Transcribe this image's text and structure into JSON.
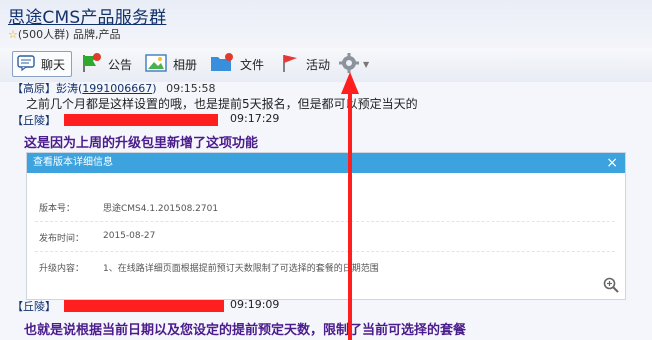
{
  "group": {
    "title": "思途CMS产品服务群",
    "member_count": "(500人群)",
    "tags": "品牌,产品"
  },
  "toolbar": {
    "chat": "聊天",
    "announcement": "公告",
    "album": "相册",
    "files": "文件",
    "activity": "活动"
  },
  "messages": {
    "m1": {
      "nick": "【高原】彭涛",
      "uid": "1991006667",
      "time": "09:15:58",
      "text": "之前几个月都是这样设置的哦，也是提前5天报名，但是都可以预定当天的"
    },
    "m2": {
      "nick": "【丘陵】",
      "time": "09:17:29",
      "text": "这是因为上周的升级包里新增了这项功能"
    },
    "m3": {
      "nick": "【丘陵】",
      "time": "09:19:09",
      "text": "也就是说根据当前日期以及您设定的提前预定天数，限制了当前可选择的套餐"
    }
  },
  "panel": {
    "title": "查看版本详细信息",
    "close": "×",
    "rows": [
      {
        "label": "版本号：",
        "value": "思途CMS4.1.201508.2701"
      },
      {
        "label": "发布时间：",
        "value": "2015-08-27"
      },
      {
        "label": "升级内容：",
        "value": "1、在线路详细页面根据提前预订天数限制了可选择的套餐的日期范围"
      }
    ]
  },
  "colors": {
    "panel_header": "#3da3df",
    "highlight_text": "#4b1c8c",
    "annotation_red": "#ff1f1f",
    "link_blue": "#13326b"
  },
  "icons": {
    "chat": "chat-bubble-icon",
    "announcement": "flag-notice-icon",
    "album": "photo-icon",
    "files": "folder-icon",
    "activity": "red-flag-icon",
    "settings": "gear-icon"
  }
}
